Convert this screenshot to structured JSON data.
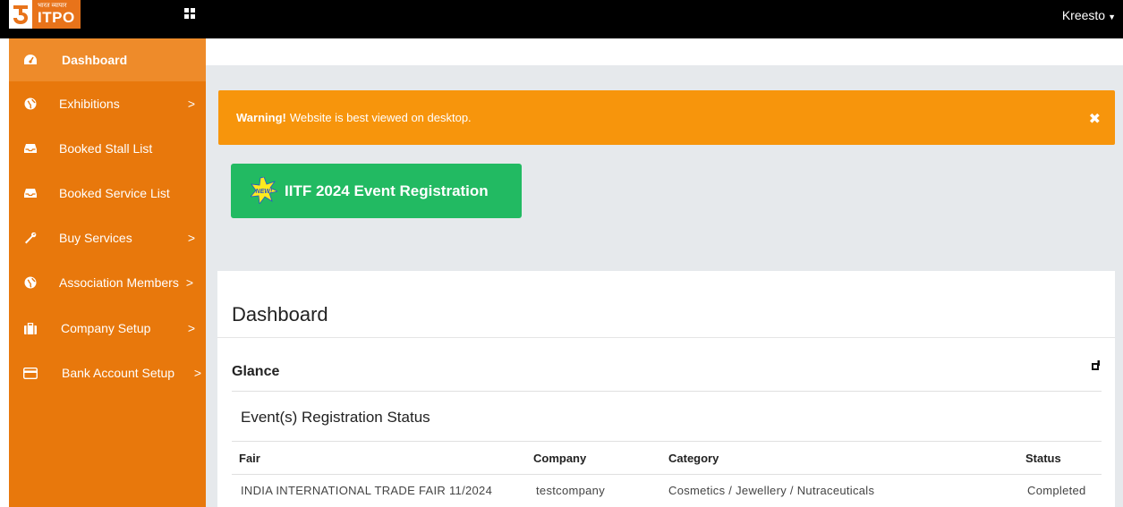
{
  "header": {
    "logo_subtext": "भारत व्यापार",
    "logo_text": "ITPO",
    "user_name": "Kreesto",
    "user_caret": "▼"
  },
  "sidebar": {
    "items": [
      {
        "label": "Dashboard",
        "icon": "dashboard-icon",
        "active": true,
        "chevron": ""
      },
      {
        "label": "Exhibitions",
        "icon": "globe-icon",
        "active": false,
        "chevron": ">"
      },
      {
        "label": "Booked Stall List",
        "icon": "inbox-icon",
        "active": false,
        "chevron": ""
      },
      {
        "label": "Booked Service List",
        "icon": "inbox-icon",
        "active": false,
        "chevron": ""
      },
      {
        "label": "Buy Services",
        "icon": "wrench-icon",
        "active": false,
        "chevron": ">"
      },
      {
        "label": "Association Members",
        "icon": "globe-icon",
        "active": false,
        "chevron": ">"
      },
      {
        "label": "Company Setup",
        "icon": "briefcase-icon",
        "active": false,
        "chevron": ">"
      },
      {
        "label": "Bank Account Setup",
        "icon": "credit-card-icon",
        "active": false,
        "chevron": ">"
      }
    ]
  },
  "alert": {
    "strong": "Warning!",
    "message": "Website is best viewed on desktop.",
    "close": "✖"
  },
  "event_button": {
    "badge": "NEW!",
    "label": "IITF 2024 Event Registration"
  },
  "panel": {
    "title": "Dashboard",
    "glance": "Glance",
    "section_title": "Event(s) Registration Status",
    "table": {
      "headers": [
        "Fair",
        "Company",
        "Category",
        "Status"
      ],
      "rows": [
        [
          "INDIA INTERNATIONAL TRADE FAIR 11/2024",
          "testcompany",
          "Cosmetics / Jewellery / Nutraceuticals",
          "Completed"
        ]
      ]
    }
  },
  "colors": {
    "sidebar": "#e8780c",
    "alert": "#f7950c",
    "success": "#22ba62"
  }
}
